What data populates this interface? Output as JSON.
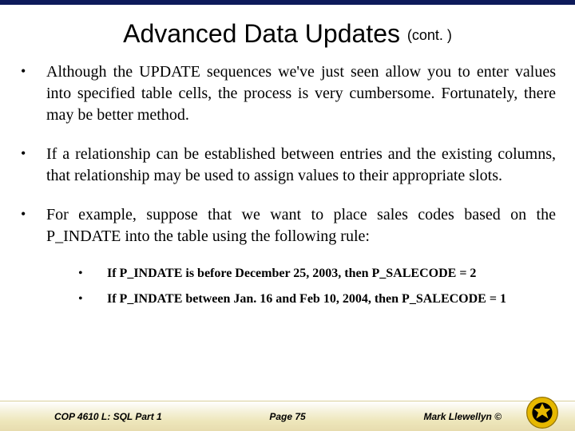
{
  "title": {
    "main": "Advanced Data Updates ",
    "cont": "(cont. )"
  },
  "bullets": [
    "Although the UPDATE sequences we've just seen allow you to enter values into specified table cells, the process is very cumbersome.  Fortunately, there may be better method.",
    "If a relationship can be established between entries and the existing columns, that relationship may be used to assign values to their appropriate slots.",
    "For example, suppose that we want to place sales codes based on the P_INDATE into the table using the following rule:"
  ],
  "subbullets": [
    "If P_INDATE is before December 25, 2003, then P_SALECODE = 2",
    "If P_INDATE  between Jan. 16 and Feb 10, 2004, then P_SALECODE = 1"
  ],
  "footer": {
    "left": "COP 4610 L: SQL Part 1",
    "center": "Page 75",
    "right": "Mark Llewellyn ©"
  }
}
